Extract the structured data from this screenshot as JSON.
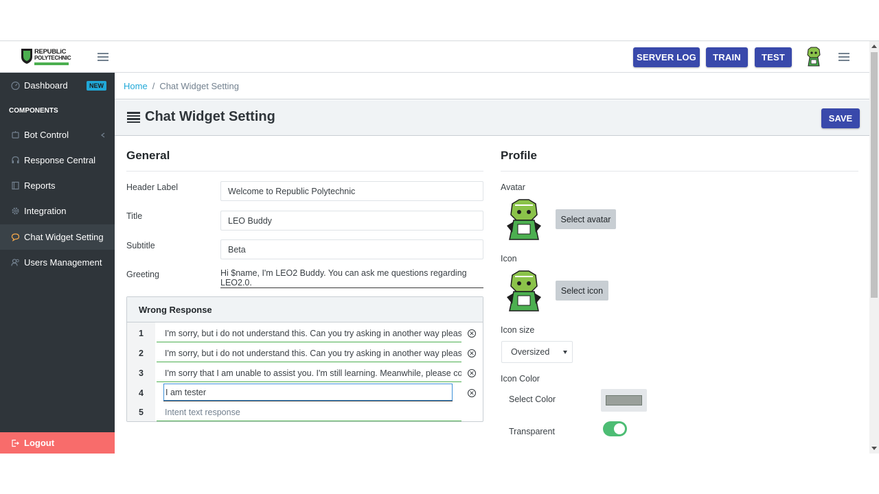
{
  "brand": {
    "line1": "REPUBLiC",
    "line2": "POLYTECHNIC"
  },
  "topbar": {
    "server_log": "SERVER LOG",
    "train": "TRAIN",
    "test": "TEST"
  },
  "sidebar": {
    "dashboard": "Dashboard",
    "new_badge": "NEW",
    "section_title": "COMPONENTS",
    "items": [
      "Bot Control",
      "Response Central",
      "Reports",
      "Integration",
      "Chat Widget Setting",
      "Users Management"
    ],
    "logout": "Logout"
  },
  "breadcrumb": {
    "home": "Home",
    "sep": "/",
    "current": "Chat Widget Setting"
  },
  "page": {
    "title": "Chat Widget Setting",
    "save": "SAVE"
  },
  "general": {
    "heading": "General",
    "header_label": {
      "label": "Header Label",
      "value": "Welcome to Republic Polytechnic"
    },
    "title": {
      "label": "Title",
      "value": "LEO Buddy"
    },
    "subtitle": {
      "label": "Subtitle",
      "value": "Beta"
    },
    "greeting": {
      "label": "Greeting",
      "value": "Hi $name, I'm LEO2 Buddy. You can ask me questions regarding LEO2.0."
    }
  },
  "wrong_response": {
    "heading": "Wrong Response",
    "rows": [
      {
        "num": "1",
        "text": "I'm sorry, but i do not understand this. Can you try asking in another way please?"
      },
      {
        "num": "2",
        "text": "I'm sorry, but i do not understand this. Can you try asking in another way please?"
      },
      {
        "num": "3",
        "text": "I'm sorry that I am unable to assist you. I'm still learning.  Meanwhile, please cont..."
      },
      {
        "num": "4",
        "text": "I am tester"
      },
      {
        "num": "5",
        "placeholder": "Intent text response"
      }
    ]
  },
  "profile": {
    "heading": "Profile",
    "avatar_label": "Avatar",
    "select_avatar": "Select avatar",
    "icon_label": "Icon",
    "select_icon": "Select icon",
    "icon_size_label": "Icon size",
    "icon_size_value": "Oversized",
    "icon_color_label": "Icon Color",
    "select_color_label": "Select Color",
    "selected_color": "#9aa09b",
    "transparent_label": "Transparent",
    "transparent_on": true
  },
  "colors": {
    "primary": "#3949ab",
    "sidebar": "#2f353a",
    "logout": "#f86c6b",
    "badge": "#20a8d8",
    "toggle": "#4dbd74"
  }
}
